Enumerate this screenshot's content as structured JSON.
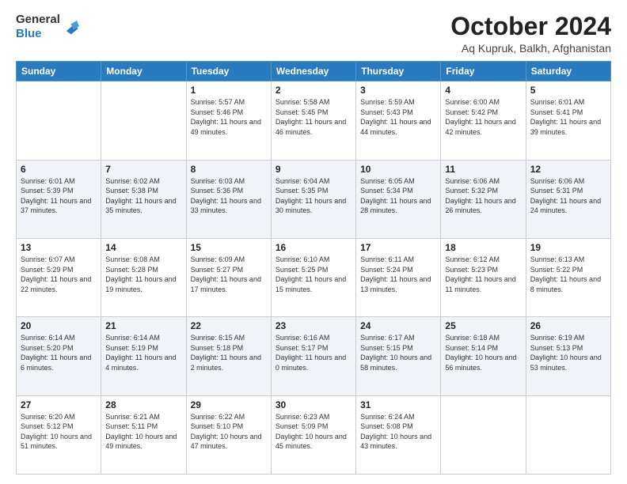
{
  "header": {
    "logo": {
      "general": "General",
      "blue": "Blue"
    },
    "month": "October 2024",
    "location": "Aq Kupruk, Balkh, Afghanistan"
  },
  "weekdays": [
    "Sunday",
    "Monday",
    "Tuesday",
    "Wednesday",
    "Thursday",
    "Friday",
    "Saturday"
  ],
  "weeks": [
    [
      {
        "day": "",
        "sunrise": "",
        "sunset": "",
        "daylight": ""
      },
      {
        "day": "",
        "sunrise": "",
        "sunset": "",
        "daylight": ""
      },
      {
        "day": "1",
        "sunrise": "Sunrise: 5:57 AM",
        "sunset": "Sunset: 5:46 PM",
        "daylight": "Daylight: 11 hours and 49 minutes."
      },
      {
        "day": "2",
        "sunrise": "Sunrise: 5:58 AM",
        "sunset": "Sunset: 5:45 PM",
        "daylight": "Daylight: 11 hours and 46 minutes."
      },
      {
        "day": "3",
        "sunrise": "Sunrise: 5:59 AM",
        "sunset": "Sunset: 5:43 PM",
        "daylight": "Daylight: 11 hours and 44 minutes."
      },
      {
        "day": "4",
        "sunrise": "Sunrise: 6:00 AM",
        "sunset": "Sunset: 5:42 PM",
        "daylight": "Daylight: 11 hours and 42 minutes."
      },
      {
        "day": "5",
        "sunrise": "Sunrise: 6:01 AM",
        "sunset": "Sunset: 5:41 PM",
        "daylight": "Daylight: 11 hours and 39 minutes."
      }
    ],
    [
      {
        "day": "6",
        "sunrise": "Sunrise: 6:01 AM",
        "sunset": "Sunset: 5:39 PM",
        "daylight": "Daylight: 11 hours and 37 minutes."
      },
      {
        "day": "7",
        "sunrise": "Sunrise: 6:02 AM",
        "sunset": "Sunset: 5:38 PM",
        "daylight": "Daylight: 11 hours and 35 minutes."
      },
      {
        "day": "8",
        "sunrise": "Sunrise: 6:03 AM",
        "sunset": "Sunset: 5:36 PM",
        "daylight": "Daylight: 11 hours and 33 minutes."
      },
      {
        "day": "9",
        "sunrise": "Sunrise: 6:04 AM",
        "sunset": "Sunset: 5:35 PM",
        "daylight": "Daylight: 11 hours and 30 minutes."
      },
      {
        "day": "10",
        "sunrise": "Sunrise: 6:05 AM",
        "sunset": "Sunset: 5:34 PM",
        "daylight": "Daylight: 11 hours and 28 minutes."
      },
      {
        "day": "11",
        "sunrise": "Sunrise: 6:06 AM",
        "sunset": "Sunset: 5:32 PM",
        "daylight": "Daylight: 11 hours and 26 minutes."
      },
      {
        "day": "12",
        "sunrise": "Sunrise: 6:06 AM",
        "sunset": "Sunset: 5:31 PM",
        "daylight": "Daylight: 11 hours and 24 minutes."
      }
    ],
    [
      {
        "day": "13",
        "sunrise": "Sunrise: 6:07 AM",
        "sunset": "Sunset: 5:29 PM",
        "daylight": "Daylight: 11 hours and 22 minutes."
      },
      {
        "day": "14",
        "sunrise": "Sunrise: 6:08 AM",
        "sunset": "Sunset: 5:28 PM",
        "daylight": "Daylight: 11 hours and 19 minutes."
      },
      {
        "day": "15",
        "sunrise": "Sunrise: 6:09 AM",
        "sunset": "Sunset: 5:27 PM",
        "daylight": "Daylight: 11 hours and 17 minutes."
      },
      {
        "day": "16",
        "sunrise": "Sunrise: 6:10 AM",
        "sunset": "Sunset: 5:25 PM",
        "daylight": "Daylight: 11 hours and 15 minutes."
      },
      {
        "day": "17",
        "sunrise": "Sunrise: 6:11 AM",
        "sunset": "Sunset: 5:24 PM",
        "daylight": "Daylight: 11 hours and 13 minutes."
      },
      {
        "day": "18",
        "sunrise": "Sunrise: 6:12 AM",
        "sunset": "Sunset: 5:23 PM",
        "daylight": "Daylight: 11 hours and 11 minutes."
      },
      {
        "day": "19",
        "sunrise": "Sunrise: 6:13 AM",
        "sunset": "Sunset: 5:22 PM",
        "daylight": "Daylight: 11 hours and 8 minutes."
      }
    ],
    [
      {
        "day": "20",
        "sunrise": "Sunrise: 6:14 AM",
        "sunset": "Sunset: 5:20 PM",
        "daylight": "Daylight: 11 hours and 6 minutes."
      },
      {
        "day": "21",
        "sunrise": "Sunrise: 6:14 AM",
        "sunset": "Sunset: 5:19 PM",
        "daylight": "Daylight: 11 hours and 4 minutes."
      },
      {
        "day": "22",
        "sunrise": "Sunrise: 6:15 AM",
        "sunset": "Sunset: 5:18 PM",
        "daylight": "Daylight: 11 hours and 2 minutes."
      },
      {
        "day": "23",
        "sunrise": "Sunrise: 6:16 AM",
        "sunset": "Sunset: 5:17 PM",
        "daylight": "Daylight: 11 hours and 0 minutes."
      },
      {
        "day": "24",
        "sunrise": "Sunrise: 6:17 AM",
        "sunset": "Sunset: 5:15 PM",
        "daylight": "Daylight: 10 hours and 58 minutes."
      },
      {
        "day": "25",
        "sunrise": "Sunrise: 6:18 AM",
        "sunset": "Sunset: 5:14 PM",
        "daylight": "Daylight: 10 hours and 56 minutes."
      },
      {
        "day": "26",
        "sunrise": "Sunrise: 6:19 AM",
        "sunset": "Sunset: 5:13 PM",
        "daylight": "Daylight: 10 hours and 53 minutes."
      }
    ],
    [
      {
        "day": "27",
        "sunrise": "Sunrise: 6:20 AM",
        "sunset": "Sunset: 5:12 PM",
        "daylight": "Daylight: 10 hours and 51 minutes."
      },
      {
        "day": "28",
        "sunrise": "Sunrise: 6:21 AM",
        "sunset": "Sunset: 5:11 PM",
        "daylight": "Daylight: 10 hours and 49 minutes."
      },
      {
        "day": "29",
        "sunrise": "Sunrise: 6:22 AM",
        "sunset": "Sunset: 5:10 PM",
        "daylight": "Daylight: 10 hours and 47 minutes."
      },
      {
        "day": "30",
        "sunrise": "Sunrise: 6:23 AM",
        "sunset": "Sunset: 5:09 PM",
        "daylight": "Daylight: 10 hours and 45 minutes."
      },
      {
        "day": "31",
        "sunrise": "Sunrise: 6:24 AM",
        "sunset": "Sunset: 5:08 PM",
        "daylight": "Daylight: 10 hours and 43 minutes."
      },
      {
        "day": "",
        "sunrise": "",
        "sunset": "",
        "daylight": ""
      },
      {
        "day": "",
        "sunrise": "",
        "sunset": "",
        "daylight": ""
      }
    ]
  ]
}
